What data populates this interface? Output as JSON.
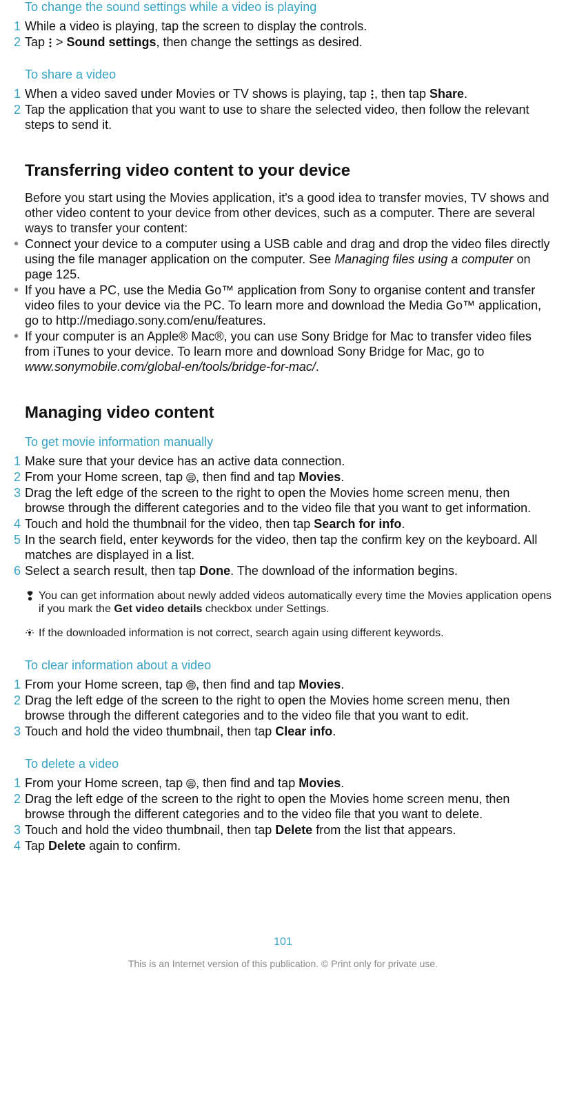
{
  "sections": {
    "sound": {
      "title": "To change the sound settings while a video is playing",
      "s1": "While a video is playing, tap the screen to display the controls.",
      "s2a": "Tap ",
      "s2b": " > ",
      "s2c": "Sound settings",
      "s2d": ", then change the settings as desired."
    },
    "share": {
      "title": "To share a video",
      "s1a": "When a video saved under Movies or TV shows is playing, tap ",
      "s1b": ", then tap ",
      "s1c": "Share",
      "s1d": ".",
      "s2": "Tap the application that you want to use to share the selected video, then follow the relevant steps to send it."
    },
    "transfer": {
      "heading": "Transferring video content to your device",
      "intro": "Before you start using the Movies application, it's a good idea to transfer movies, TV shows and other video content to your device from other devices, such as a computer. There are several ways to transfer your content:",
      "b1a": "Connect your device to a computer using a USB cable and drag and drop the video files directly using the file manager application on the computer. See ",
      "b1b": "Managing files using a computer",
      "b1c": " on page 125.",
      "b2": "If you have a PC, use the Media Go™ application from Sony to organise content and transfer video files to your device via the PC. To learn more and download the Media Go™ application, go to http://mediago.sony.com/enu/features.",
      "b3a": "If your computer is an Apple® Mac®, you can use Sony Bridge for Mac to transfer video files from iTunes to your device. To learn more and download Sony Bridge for Mac, go to ",
      "b3b": "www.sonymobile.com/global-en/tools/bridge-for-mac/",
      "b3c": "."
    },
    "manage": {
      "heading": "Managing video content"
    },
    "getinfo": {
      "title": "To get movie information manually",
      "s1": "Make sure that your device has an active data connection.",
      "s2a": "From your Home screen, tap ",
      "s2b": ", then find and tap ",
      "s2c": "Movies",
      "s2d": ".",
      "s3": "Drag the left edge of the screen to the right to open the Movies home screen menu, then browse through the different categories and to the video file that you want to get information.",
      "s4a": "Touch and hold the thumbnail for the video, then tap ",
      "s4b": "Search for info",
      "s4c": ".",
      "s5": "In the search field, enter keywords for the video, then tap the confirm key on the keyboard. All matches are displayed in a list.",
      "s6a": "Select a search result, then tap ",
      "s6b": "Done",
      "s6c": ". The download of the information begins.",
      "note1a": "You can get information about newly added videos automatically every time the Movies application opens if you mark the ",
      "note1b": "Get video details",
      "note1c": " checkbox under Settings.",
      "note2": " If the downloaded information is not correct, search again using different keywords."
    },
    "clear": {
      "title": "To clear information about a video",
      "s1a": "From your Home screen, tap ",
      "s1b": ", then find and tap ",
      "s1c": "Movies",
      "s1d": ".",
      "s2": "Drag the left edge of the screen to the right to open the Movies home screen menu, then browse through the different categories and to the video file that you want to edit.",
      "s3a": "Touch and hold the video thumbnail, then tap ",
      "s3b": "Clear info",
      "s3c": "."
    },
    "delete": {
      "title": "To delete a video",
      "s1a": "From your Home screen, tap ",
      "s1b": ", then find and tap ",
      "s1c": "Movies",
      "s1d": ".",
      "s2": "Drag the left edge of the screen to the right to open the Movies home screen menu, then browse through the different categories and to the video file that you want to delete.",
      "s3a": "Touch and hold the video thumbnail, then tap ",
      "s3b": "Delete",
      "s3c": " from the list that appears.",
      "s4a": "Tap ",
      "s4b": "Delete",
      "s4c": " again to confirm."
    }
  },
  "pageNumber": "101",
  "footer": "This is an Internet version of this publication. © Print only for private use."
}
